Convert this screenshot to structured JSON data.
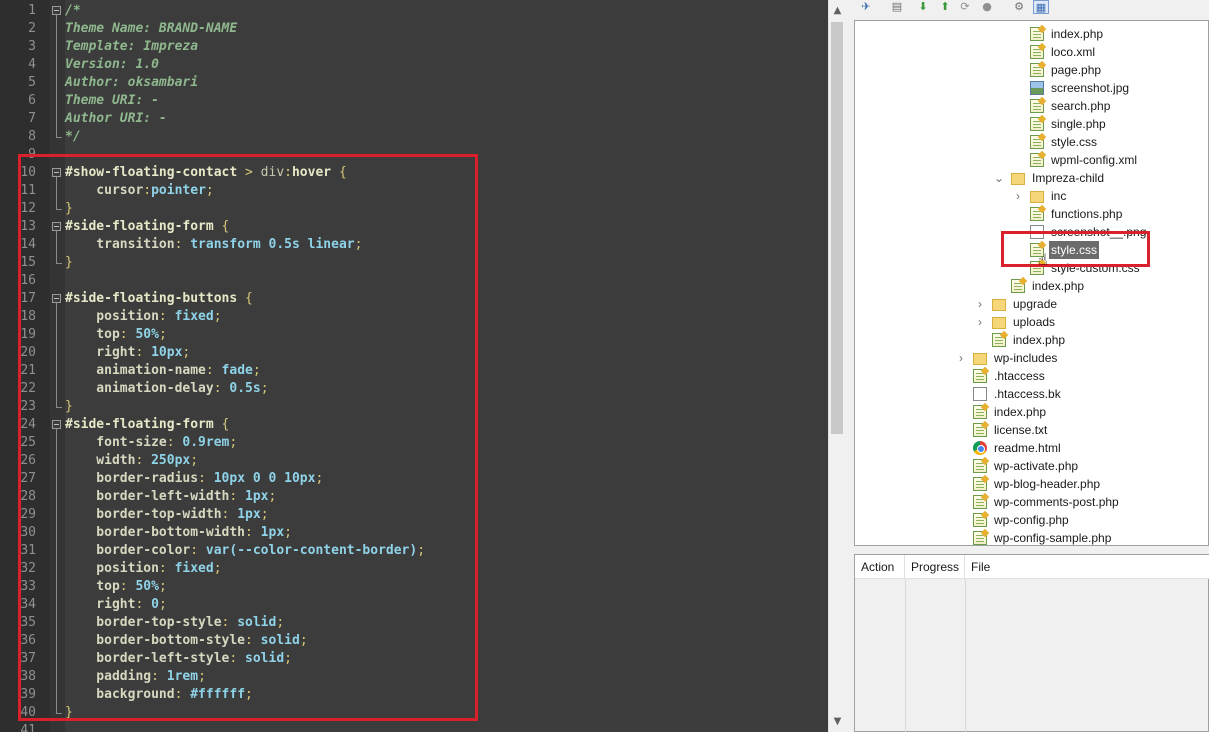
{
  "editor": {
    "lines": [
      {
        "n": "1",
        "tokens": [
          {
            "t": "/*",
            "c": "com"
          }
        ]
      },
      {
        "n": "2",
        "tokens": [
          {
            "t": "Theme Name: BRAND-NAME",
            "c": "com"
          }
        ]
      },
      {
        "n": "3",
        "tokens": [
          {
            "t": "Template: Impreza",
            "c": "com"
          }
        ]
      },
      {
        "n": "4",
        "tokens": [
          {
            "t": "Version: 1.0",
            "c": "com"
          }
        ]
      },
      {
        "n": "5",
        "tokens": [
          {
            "t": "Author: oksambari",
            "c": "com"
          }
        ]
      },
      {
        "n": "6",
        "tokens": [
          {
            "t": "Theme URI: -",
            "c": "com"
          }
        ]
      },
      {
        "n": "7",
        "tokens": [
          {
            "t": "Author URI: -",
            "c": "com"
          }
        ]
      },
      {
        "n": "8",
        "tokens": [
          {
            "t": "*/",
            "c": "com"
          }
        ]
      },
      {
        "n": "9",
        "tokens": []
      },
      {
        "n": "10",
        "tokens": [
          {
            "t": "#show-floating-contact",
            "c": "sel"
          },
          {
            "t": " > ",
            "c": "pun"
          },
          {
            "t": "div",
            "c": "tag"
          },
          {
            "t": ":",
            "c": "pun"
          },
          {
            "t": "hover",
            "c": "sel"
          },
          {
            "t": " {",
            "c": "pun"
          }
        ]
      },
      {
        "n": "11",
        "tokens": [
          {
            "t": "    cursor",
            "c": "prop"
          },
          {
            "t": ":",
            "c": "pun"
          },
          {
            "t": "pointer",
            "c": "val"
          },
          {
            "t": ";",
            "c": "pun"
          }
        ]
      },
      {
        "n": "12",
        "tokens": [
          {
            "t": "}",
            "c": "pun"
          }
        ]
      },
      {
        "n": "13",
        "tokens": [
          {
            "t": "#side-floating-form",
            "c": "sel"
          },
          {
            "t": " {",
            "c": "pun"
          }
        ]
      },
      {
        "n": "14",
        "tokens": [
          {
            "t": "    transition",
            "c": "prop"
          },
          {
            "t": ": ",
            "c": "pun"
          },
          {
            "t": "transform 0.5s linear",
            "c": "val"
          },
          {
            "t": ";",
            "c": "pun"
          }
        ]
      },
      {
        "n": "15",
        "tokens": [
          {
            "t": "}",
            "c": "pun"
          }
        ]
      },
      {
        "n": "16",
        "tokens": []
      },
      {
        "n": "17",
        "tokens": [
          {
            "t": "#side-floating-buttons",
            "c": "sel"
          },
          {
            "t": " {",
            "c": "pun"
          }
        ]
      },
      {
        "n": "18",
        "tokens": [
          {
            "t": "    position",
            "c": "prop"
          },
          {
            "t": ": ",
            "c": "pun"
          },
          {
            "t": "fixed",
            "c": "val"
          },
          {
            "t": ";",
            "c": "pun"
          }
        ]
      },
      {
        "n": "19",
        "tokens": [
          {
            "t": "    top",
            "c": "prop"
          },
          {
            "t": ": ",
            "c": "pun"
          },
          {
            "t": "50%",
            "c": "val"
          },
          {
            "t": ";",
            "c": "pun"
          }
        ]
      },
      {
        "n": "20",
        "tokens": [
          {
            "t": "    right",
            "c": "prop"
          },
          {
            "t": ": ",
            "c": "pun"
          },
          {
            "t": "10px",
            "c": "val"
          },
          {
            "t": ";",
            "c": "pun"
          }
        ]
      },
      {
        "n": "21",
        "tokens": [
          {
            "t": "    animation-name",
            "c": "prop"
          },
          {
            "t": ": ",
            "c": "pun"
          },
          {
            "t": "fade",
            "c": "val"
          },
          {
            "t": ";",
            "c": "pun"
          }
        ]
      },
      {
        "n": "22",
        "tokens": [
          {
            "t": "    animation-delay",
            "c": "prop"
          },
          {
            "t": ": ",
            "c": "pun"
          },
          {
            "t": "0.5s",
            "c": "val"
          },
          {
            "t": ";",
            "c": "pun"
          }
        ]
      },
      {
        "n": "23",
        "tokens": [
          {
            "t": "}",
            "c": "pun"
          }
        ]
      },
      {
        "n": "24",
        "tokens": [
          {
            "t": "#side-floating-form",
            "c": "sel"
          },
          {
            "t": " {",
            "c": "pun"
          }
        ]
      },
      {
        "n": "25",
        "tokens": [
          {
            "t": "    font-size",
            "c": "prop"
          },
          {
            "t": ": ",
            "c": "pun"
          },
          {
            "t": "0.9rem",
            "c": "val"
          },
          {
            "t": ";",
            "c": "pun"
          }
        ]
      },
      {
        "n": "26",
        "tokens": [
          {
            "t": "    width",
            "c": "prop"
          },
          {
            "t": ": ",
            "c": "pun"
          },
          {
            "t": "250px",
            "c": "val"
          },
          {
            "t": ";",
            "c": "pun"
          }
        ]
      },
      {
        "n": "27",
        "tokens": [
          {
            "t": "    border-radius",
            "c": "prop"
          },
          {
            "t": ": ",
            "c": "pun"
          },
          {
            "t": "10px 0 0 10px",
            "c": "val"
          },
          {
            "t": ";",
            "c": "pun"
          }
        ]
      },
      {
        "n": "28",
        "tokens": [
          {
            "t": "    border-left-width",
            "c": "prop"
          },
          {
            "t": ": ",
            "c": "pun"
          },
          {
            "t": "1px",
            "c": "val"
          },
          {
            "t": ";",
            "c": "pun"
          }
        ]
      },
      {
        "n": "29",
        "tokens": [
          {
            "t": "    border-top-width",
            "c": "prop"
          },
          {
            "t": ": ",
            "c": "pun"
          },
          {
            "t": "1px",
            "c": "val"
          },
          {
            "t": ";",
            "c": "pun"
          }
        ]
      },
      {
        "n": "30",
        "tokens": [
          {
            "t": "    border-bottom-width",
            "c": "prop"
          },
          {
            "t": ": ",
            "c": "pun"
          },
          {
            "t": "1px",
            "c": "val"
          },
          {
            "t": ";",
            "c": "pun"
          }
        ]
      },
      {
        "n": "31",
        "tokens": [
          {
            "t": "    border-color",
            "c": "prop"
          },
          {
            "t": ": ",
            "c": "pun"
          },
          {
            "t": "var(--color-content-border)",
            "c": "val"
          },
          {
            "t": ";",
            "c": "pun"
          }
        ]
      },
      {
        "n": "32",
        "tokens": [
          {
            "t": "    position",
            "c": "prop"
          },
          {
            "t": ": ",
            "c": "pun"
          },
          {
            "t": "fixed",
            "c": "val"
          },
          {
            "t": ";",
            "c": "pun"
          }
        ]
      },
      {
        "n": "33",
        "tokens": [
          {
            "t": "    top",
            "c": "prop"
          },
          {
            "t": ": ",
            "c": "pun"
          },
          {
            "t": "50%",
            "c": "val"
          },
          {
            "t": ";",
            "c": "pun"
          }
        ]
      },
      {
        "n": "34",
        "tokens": [
          {
            "t": "    right",
            "c": "prop"
          },
          {
            "t": ": ",
            "c": "pun"
          },
          {
            "t": "0",
            "c": "val"
          },
          {
            "t": ";",
            "c": "pun"
          }
        ]
      },
      {
        "n": "35",
        "tokens": [
          {
            "t": "    border-top-style",
            "c": "prop"
          },
          {
            "t": ": ",
            "c": "pun"
          },
          {
            "t": "solid",
            "c": "val"
          },
          {
            "t": ";",
            "c": "pun"
          }
        ]
      },
      {
        "n": "36",
        "tokens": [
          {
            "t": "    border-bottom-style",
            "c": "prop"
          },
          {
            "t": ": ",
            "c": "pun"
          },
          {
            "t": "solid",
            "c": "val"
          },
          {
            "t": ";",
            "c": "pun"
          }
        ]
      },
      {
        "n": "37",
        "tokens": [
          {
            "t": "    border-left-style",
            "c": "prop"
          },
          {
            "t": ": ",
            "c": "pun"
          },
          {
            "t": "solid",
            "c": "val"
          },
          {
            "t": ";",
            "c": "pun"
          }
        ]
      },
      {
        "n": "38",
        "tokens": [
          {
            "t": "    padding",
            "c": "prop"
          },
          {
            "t": ": ",
            "c": "pun"
          },
          {
            "t": "1rem",
            "c": "val"
          },
          {
            "t": ";",
            "c": "pun"
          }
        ]
      },
      {
        "n": "39",
        "tokens": [
          {
            "t": "    background",
            "c": "prop"
          },
          {
            "t": ": ",
            "c": "pun"
          },
          {
            "t": "#ffffff",
            "c": "val"
          },
          {
            "t": ";",
            "c": "pun"
          }
        ]
      },
      {
        "n": "40",
        "tokens": [
          {
            "t": "}",
            "c": "pun"
          }
        ]
      },
      {
        "n": "41",
        "tokens": []
      }
    ]
  },
  "file_tree": {
    "items": [
      {
        "label": "index.php",
        "icon": "php-file-icon",
        "depth": 4,
        "expander": ""
      },
      {
        "label": "loco.xml",
        "icon": "php-file-icon",
        "depth": 4,
        "expander": ""
      },
      {
        "label": "page.php",
        "icon": "php-file-icon",
        "depth": 4,
        "expander": ""
      },
      {
        "label": "screenshot.jpg",
        "icon": "image-file-icon",
        "depth": 4,
        "expander": ""
      },
      {
        "label": "search.php",
        "icon": "php-file-icon",
        "depth": 4,
        "expander": ""
      },
      {
        "label": "single.php",
        "icon": "php-file-icon",
        "depth": 4,
        "expander": ""
      },
      {
        "label": "style.css",
        "icon": "php-file-icon",
        "depth": 4,
        "expander": ""
      },
      {
        "label": "wpml-config.xml",
        "icon": "php-file-icon",
        "depth": 4,
        "expander": ""
      },
      {
        "label": "Impreza-child",
        "icon": "folder-icon",
        "depth": 3,
        "expander": "expanded"
      },
      {
        "label": "inc",
        "icon": "folder-icon",
        "depth": 4,
        "expander": "collapsed"
      },
      {
        "label": "functions.php",
        "icon": "php-file-icon",
        "depth": 4,
        "expander": ""
      },
      {
        "label": "screenshot__.png",
        "icon": "blank-file-icon",
        "depth": 4,
        "expander": ""
      },
      {
        "label": "style.css",
        "icon": "php-file-icon",
        "depth": 4,
        "expander": "",
        "selected": true
      },
      {
        "label": "style-custom.css",
        "icon": "php-file-icon",
        "depth": 4,
        "expander": ""
      },
      {
        "label": "index.php",
        "icon": "php-file-icon",
        "depth": 3,
        "expander": ""
      },
      {
        "label": "upgrade",
        "icon": "folder-icon",
        "depth": 2,
        "expander": "collapsed"
      },
      {
        "label": "uploads",
        "icon": "folder-icon",
        "depth": 2,
        "expander": "collapsed"
      },
      {
        "label": "index.php",
        "icon": "php-file-icon",
        "depth": 2,
        "expander": ""
      },
      {
        "label": "wp-includes",
        "icon": "folder-icon",
        "depth": 1,
        "expander": "collapsed"
      },
      {
        "label": ".htaccess",
        "icon": "php-file-icon",
        "depth": 1,
        "expander": ""
      },
      {
        "label": ".htaccess.bk",
        "icon": "blank-file-icon",
        "depth": 1,
        "expander": ""
      },
      {
        "label": "index.php",
        "icon": "php-file-icon",
        "depth": 1,
        "expander": ""
      },
      {
        "label": "license.txt",
        "icon": "php-file-icon",
        "depth": 1,
        "expander": ""
      },
      {
        "label": "readme.html",
        "icon": "chrome-icon",
        "depth": 1,
        "expander": ""
      },
      {
        "label": "wp-activate.php",
        "icon": "php-file-icon",
        "depth": 1,
        "expander": ""
      },
      {
        "label": "wp-blog-header.php",
        "icon": "php-file-icon",
        "depth": 1,
        "expander": ""
      },
      {
        "label": "wp-comments-post.php",
        "icon": "php-file-icon",
        "depth": 1,
        "expander": ""
      },
      {
        "label": "wp-config.php",
        "icon": "php-file-icon",
        "depth": 1,
        "expander": ""
      },
      {
        "label": "wp-config-sample.php",
        "icon": "php-file-icon",
        "depth": 1,
        "expander": ""
      }
    ]
  },
  "queue": {
    "col_action": "Action",
    "col_progress": "Progress",
    "col_file": "File"
  },
  "colors": {
    "editor_bg": "#3c3c3c",
    "highlight": "#d9202b",
    "selected_bg": "#6b6b6b"
  }
}
